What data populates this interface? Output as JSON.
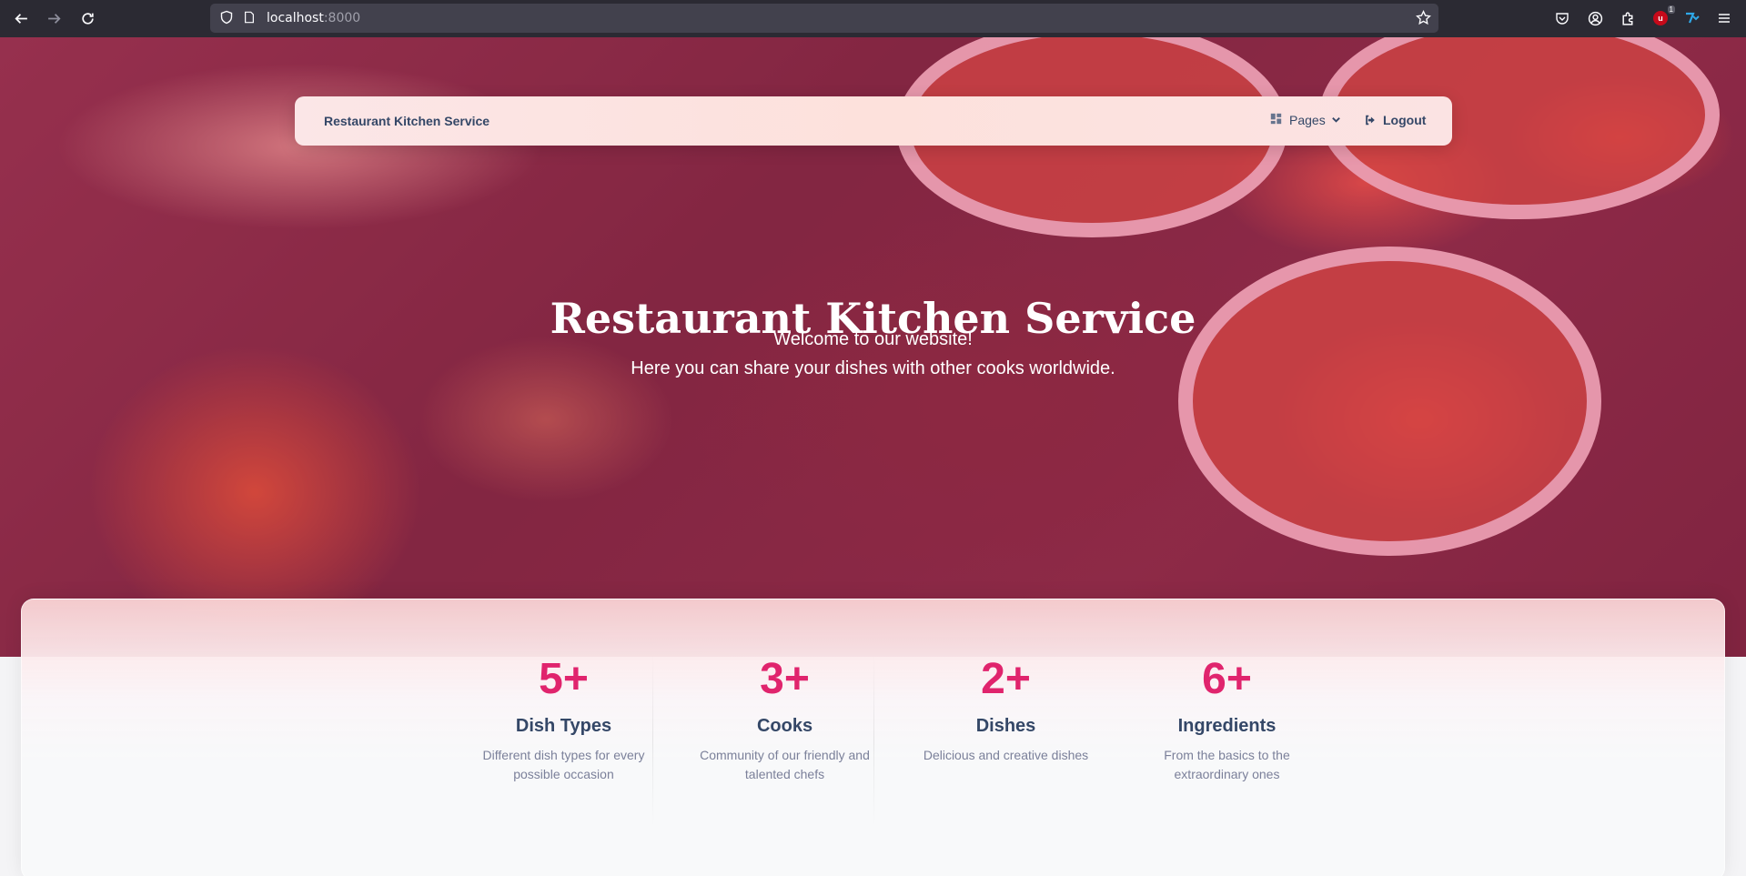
{
  "browser": {
    "url_host": "localhost",
    "url_port": ":8000",
    "extension_badge_count": "1"
  },
  "navbar": {
    "brand": "Restaurant Kitchen Service",
    "pages_label": "Pages",
    "logout_label": "Logout"
  },
  "hero": {
    "title": "Restaurant Kitchen Service",
    "subtitle_line1": "Welcome to our website!",
    "subtitle_line2": "Here you can share your dishes with other cooks worldwide."
  },
  "stats": [
    {
      "number": "5+",
      "title": "Dish Types",
      "description": "Different dish types for every possible occasion"
    },
    {
      "number": "3+",
      "title": "Cooks",
      "description": "Community of our friendly and talented chefs"
    },
    {
      "number": "2+",
      "title": "Dishes",
      "description": "Delicious and creative dishes"
    },
    {
      "number": "6+",
      "title": "Ingredients",
      "description": "From the basics to the extraordinary ones"
    }
  ],
  "colors": {
    "accent": "#e0246d",
    "heading": "#344767",
    "muted": "#7b809a"
  }
}
